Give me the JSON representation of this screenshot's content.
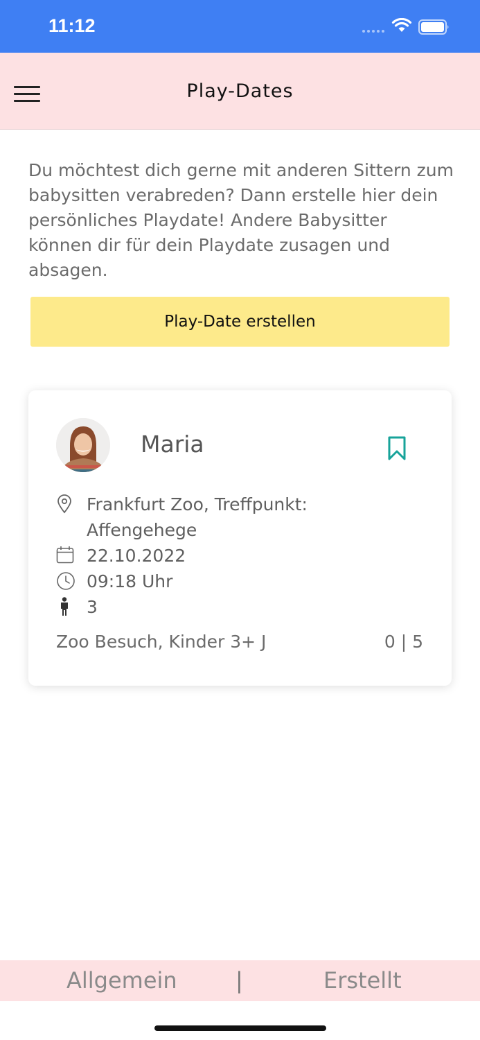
{
  "status_bar": {
    "time": "11:12"
  },
  "header": {
    "title": "Play-Dates",
    "menu_icon": "hamburger-menu-icon"
  },
  "intro_text": "Du möchtest dich gerne mit anderen Sittern zum babysitten verabreden? Dann erstelle hier dein persönliches Playdate! Andere Babysitter können dir für dein Playdate zusagen und absagen.",
  "create_button": {
    "label": "Play-Date erstellen",
    "color": "#fdea8b"
  },
  "playdate_card": {
    "name": "Maria",
    "location": "Frankfurt Zoo, Treffpunkt: Affengehege",
    "date": "22.10.2022",
    "time": "09:18 Uhr",
    "children": "3",
    "description": "Zoo Besuch, Kinder 3+ J",
    "participants": "0 | 5",
    "bookmark_color": "#17a39a"
  },
  "tabs": {
    "left": "Allgemein",
    "separator": "|",
    "right": "Erstellt"
  },
  "colors": {
    "status_bar": "#3f7ff3",
    "header_bg": "#fde1e3",
    "tab_bar_bg": "#fde1e3"
  }
}
